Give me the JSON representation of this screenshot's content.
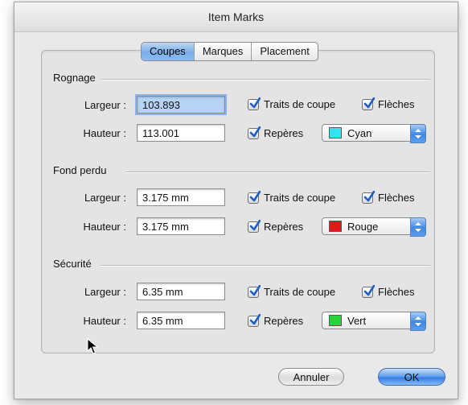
{
  "window": {
    "title": "Item Marks"
  },
  "tabs": [
    {
      "label": "Coupes",
      "active": true
    },
    {
      "label": "Marques",
      "active": false
    },
    {
      "label": "Placement",
      "active": false
    }
  ],
  "sections": [
    {
      "title": "Rognage",
      "largeur_label": "Largeur :",
      "largeur_value": "103.893",
      "hauteur_label": "Hauteur :",
      "hauteur_value": "113.001",
      "traits_label": "Traits de coupe",
      "traits_checked": true,
      "fleches_label": "Flèches",
      "fleches_checked": true,
      "reperes_label": "Repères",
      "reperes_checked": true,
      "color_label": "Cyan",
      "color_hex": "#2fe5f0"
    },
    {
      "title": "Fond perdu",
      "largeur_label": "Largeur :",
      "largeur_value": "3.175 mm",
      "hauteur_label": "Hauteur :",
      "hauteur_value": "3.175 mm",
      "traits_label": "Traits de coupe",
      "traits_checked": true,
      "fleches_label": "Flèches",
      "fleches_checked": true,
      "reperes_label": "Repères",
      "reperes_checked": true,
      "color_label": "Rouge",
      "color_hex": "#e41616"
    },
    {
      "title": "Sécurité",
      "largeur_label": "Largeur :",
      "largeur_value": "6.35 mm",
      "hauteur_label": "Hauteur :",
      "hauteur_value": "6.35 mm",
      "traits_label": "Traits de coupe",
      "traits_checked": true,
      "fleches_label": "Flèches",
      "fleches_checked": true,
      "reperes_label": "Repères",
      "reperes_checked": true,
      "color_label": "Vert",
      "color_hex": "#24d63b"
    }
  ],
  "buttons": {
    "cancel_label": "Annuler",
    "ok_label": "OK"
  },
  "colors": {
    "accent": "#3f88e4",
    "check": "#1d5fc6"
  }
}
